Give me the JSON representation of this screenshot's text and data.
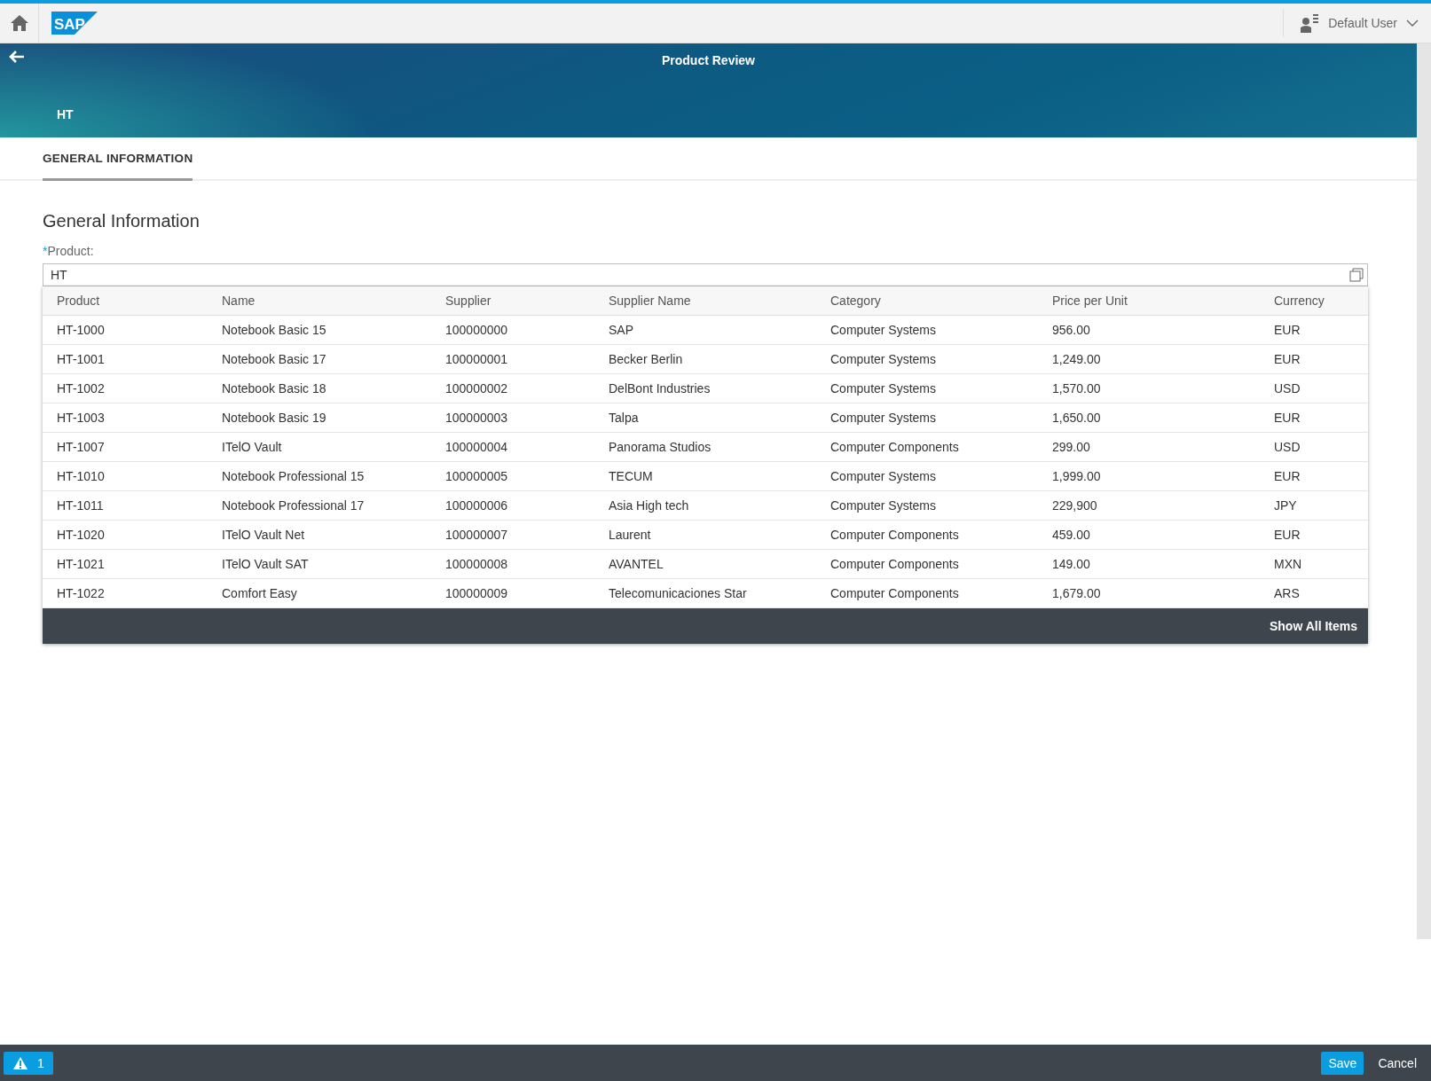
{
  "shell": {
    "logo": "SAP",
    "user": "Default User"
  },
  "header": {
    "title": "Product Review",
    "object_title": "HT"
  },
  "tabs": [
    {
      "label": "GENERAL INFORMATION",
      "selected": true
    }
  ],
  "section": {
    "title": "General Information",
    "field": {
      "label": "Product:",
      "required_mark": "*",
      "value": "HT"
    }
  },
  "suggestions": {
    "columns": [
      "Product",
      "Name",
      "Supplier",
      "Supplier Name",
      "Category",
      "Price per Unit",
      "Currency"
    ],
    "rows": [
      [
        "HT-1000",
        "Notebook Basic 15",
        "100000000",
        "SAP",
        "Computer Systems",
        "956.00",
        "EUR"
      ],
      [
        "HT-1001",
        "Notebook Basic 17",
        "100000001",
        "Becker Berlin",
        "Computer Systems",
        "1,249.00",
        "EUR"
      ],
      [
        "HT-1002",
        "Notebook Basic 18",
        "100000002",
        "DelBont Industries",
        "Computer Systems",
        "1,570.00",
        "USD"
      ],
      [
        "HT-1003",
        "Notebook Basic 19",
        "100000003",
        "Talpa",
        "Computer Systems",
        "1,650.00",
        "EUR"
      ],
      [
        "HT-1007",
        "ITelO Vault",
        "100000004",
        "Panorama Studios",
        "Computer Components",
        "299.00",
        "USD"
      ],
      [
        "HT-1010",
        "Notebook Professional 15",
        "100000005",
        "TECUM",
        "Computer Systems",
        "1,999.00",
        "EUR"
      ],
      [
        "HT-1011",
        "Notebook Professional 17",
        "100000006",
        "Asia High tech",
        "Computer Systems",
        "229,900",
        "JPY"
      ],
      [
        "HT-1020",
        "ITelO Vault Net",
        "100000007",
        "Laurent",
        "Computer Components",
        "459.00",
        "EUR"
      ],
      [
        "HT-1021",
        "ITelO Vault SAT",
        "100000008",
        "AVANTEL",
        "Computer Components",
        "149.00",
        "MXN"
      ],
      [
        "HT-1022",
        "Comfort Easy",
        "100000009",
        "Telecomunicaciones Star",
        "Computer Components",
        "1,679.00",
        "ARS"
      ]
    ],
    "show_all": "Show All Items"
  },
  "footer": {
    "message_count": "1",
    "buttons": [
      {
        "label": "Save",
        "kind": "emphasized"
      },
      {
        "label": "Cancel",
        "kind": "transparent"
      }
    ]
  }
}
